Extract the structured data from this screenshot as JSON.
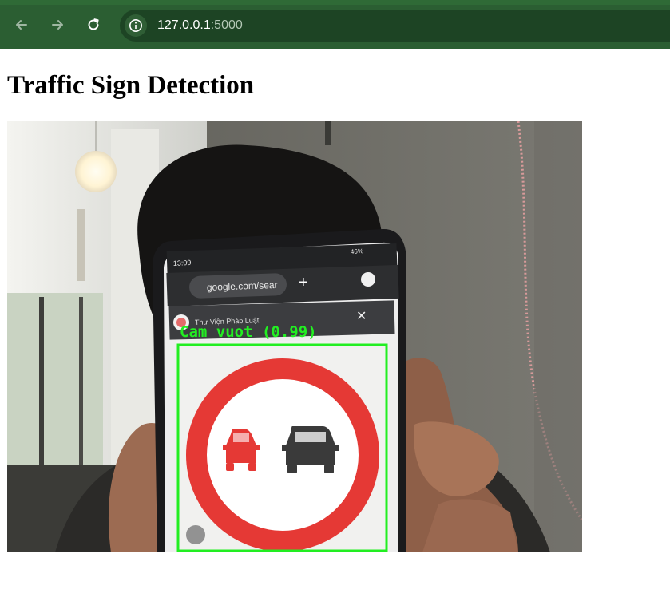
{
  "browser": {
    "url_host": "127.0.0.1",
    "url_port": ":5000",
    "back_icon": "arrow-left-icon",
    "forward_icon": "arrow-right-icon",
    "reload_icon": "reload-icon",
    "site_info_icon": "info-icon"
  },
  "page": {
    "title": "Traffic Sign Detection"
  },
  "video_feed": {
    "detection": {
      "label": "Cam vuot (0.99)",
      "box_color": "#22ee22"
    },
    "phone_screen": {
      "status_time": "13:09",
      "status_battery": "46%",
      "address": "google.com/sear",
      "site_name": "Thư Viện Pháp Luật"
    },
    "sign_colors": {
      "ring": "#e53935",
      "left_car": "#e53935",
      "right_car": "#3a3a3a"
    }
  }
}
